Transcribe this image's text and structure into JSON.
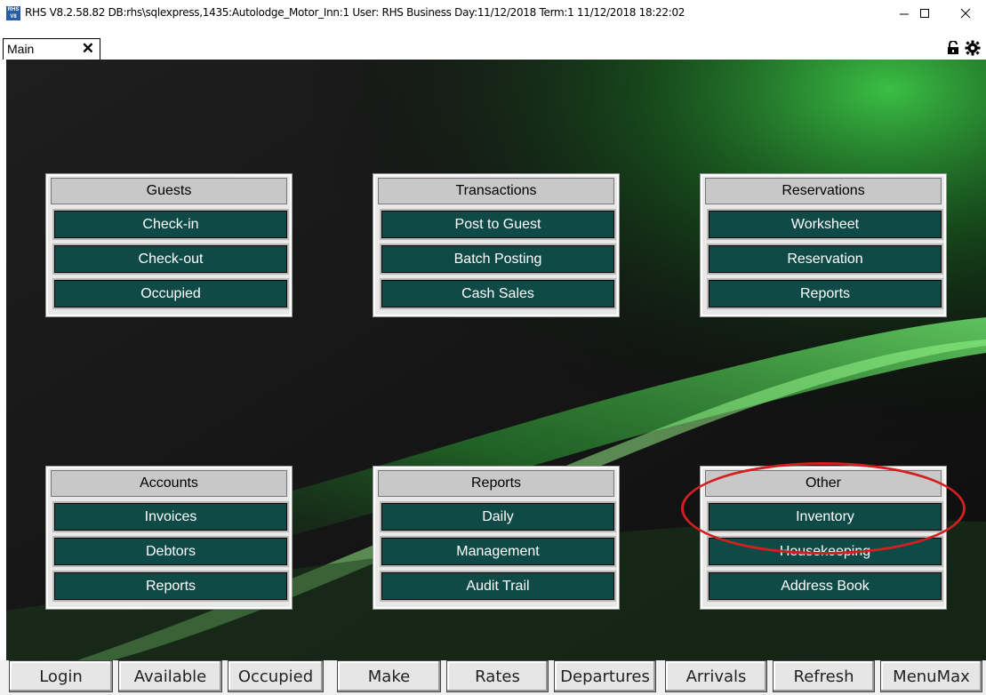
{
  "window": {
    "title": "RHS V8.2.58.82  DB:rhs\\sqlexpress,1435:Autolodge_Motor_Inn:1   User: RHS    Business Day:11/12/2018  Term:1  11/12/2018 18:22:02",
    "app_icon_text": "RHS V8"
  },
  "tab": {
    "label": "Main",
    "close_glyph": "✕"
  },
  "panels": [
    {
      "title": "Guests",
      "buttons": [
        "Check-in",
        "Check-out",
        "Occupied"
      ]
    },
    {
      "title": "Transactions",
      "buttons": [
        "Post to Guest",
        "Batch Posting",
        "Cash Sales"
      ]
    },
    {
      "title": "Reservations",
      "buttons": [
        "Worksheet",
        "Reservation",
        "Reports"
      ]
    },
    {
      "title": "Accounts",
      "buttons": [
        "Invoices",
        "Debtors",
        "Reports"
      ]
    },
    {
      "title": "Reports",
      "buttons": [
        "Daily",
        "Management",
        "Audit Trail"
      ]
    },
    {
      "title": "Other",
      "buttons": [
        "Inventory",
        "Housekeeping",
        "Address Book"
      ]
    }
  ],
  "bottom_bar": [
    "Login",
    "Available",
    "Occupied",
    "Make",
    "Rates",
    "Departures",
    "Arrivals",
    "Refresh",
    "MenuMax"
  ],
  "colors": {
    "button_fill": "#0f4a47",
    "panel_head": "#c8c8c8",
    "highlight": "#d21f1f",
    "background_green": "#2fbf3a"
  },
  "icons": [
    "lock-icon",
    "gear-icon",
    "minimize-icon",
    "maximize-icon",
    "close-icon"
  ]
}
